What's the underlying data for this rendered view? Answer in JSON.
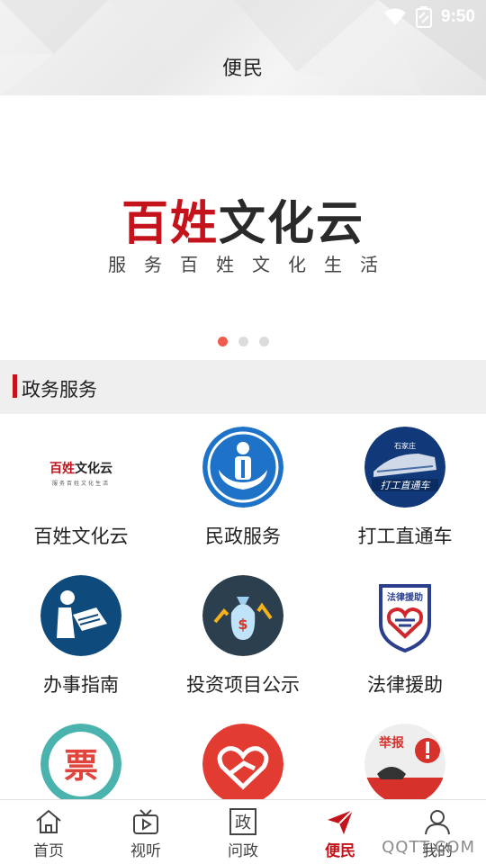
{
  "status_bar": {
    "time": "9:50",
    "icons": [
      "wifi-icon",
      "battery-icon"
    ]
  },
  "header": {
    "title": "便民"
  },
  "banner": {
    "title_red": "百姓",
    "title_dark": "文化云",
    "subtitle": "服务百姓文化生活",
    "slides": 3,
    "active_slide": 1
  },
  "section": {
    "title": "政务服务"
  },
  "services": [
    {
      "label": "百姓文化云",
      "icon": "baixing-culture-cloud-logo",
      "logo_text": "百姓文化云",
      "logo_sub": "服务百姓文化生活"
    },
    {
      "label": "民政服务",
      "icon": "civil-affairs-icon"
    },
    {
      "label": "打工直通车",
      "icon": "worker-train-icon",
      "logo_text": "打工直通车",
      "logo_top": "石家庄"
    },
    {
      "label": "办事指南",
      "icon": "guide-reading-icon"
    },
    {
      "label": "投资项目公示",
      "icon": "investment-moneybag-icon"
    },
    {
      "label": "法律援助",
      "icon": "legal-aid-icon",
      "logo_text": "法律援助"
    },
    {
      "label": "",
      "icon": "ticket-icon",
      "logo_text": "票"
    },
    {
      "label": "",
      "icon": "helping-hands-icon"
    },
    {
      "label": "",
      "icon": "report-phone-icon",
      "logo_text": "举报"
    }
  ],
  "bottom_nav": [
    {
      "label": "首页",
      "icon": "home-icon",
      "active": false
    },
    {
      "label": "视听",
      "icon": "tv-icon",
      "active": false
    },
    {
      "label": "问政",
      "icon": "gov-icon",
      "glyph": "政",
      "active": false
    },
    {
      "label": "便民",
      "icon": "send-icon",
      "active": true
    },
    {
      "label": "我的",
      "icon": "user-icon",
      "active": false
    }
  ],
  "watermark": "QQTT.COM",
  "colors": {
    "accent": "#c4131b",
    "dot_active": "#f05a4f",
    "civil_blue": "#1e73c8",
    "guide_navy": "#0e4a7c"
  }
}
